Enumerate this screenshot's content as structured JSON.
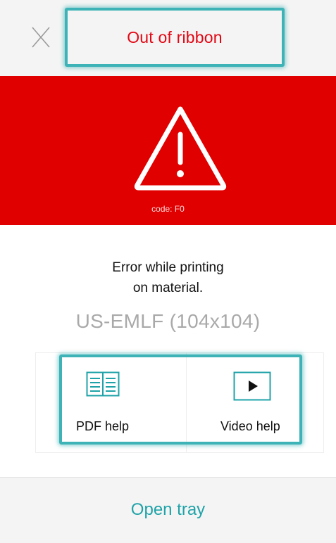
{
  "header": {
    "close_icon": "close-icon",
    "title": "Out of ribbon"
  },
  "alert": {
    "icon": "warning-icon",
    "code": "code: F0",
    "color": "#e10000"
  },
  "message": {
    "line1": "Error while printing",
    "line2": "on material."
  },
  "material": "US-EMLF (104x104)",
  "help": {
    "pdf": {
      "icon": "book-icon",
      "label": "PDF help"
    },
    "video": {
      "icon": "play-icon",
      "label": "Video help"
    }
  },
  "footer": {
    "label": "Open tray"
  },
  "colors": {
    "accent": "#3eb3b7",
    "title_red": "#e30613",
    "teal_text": "#1fa3a8"
  }
}
